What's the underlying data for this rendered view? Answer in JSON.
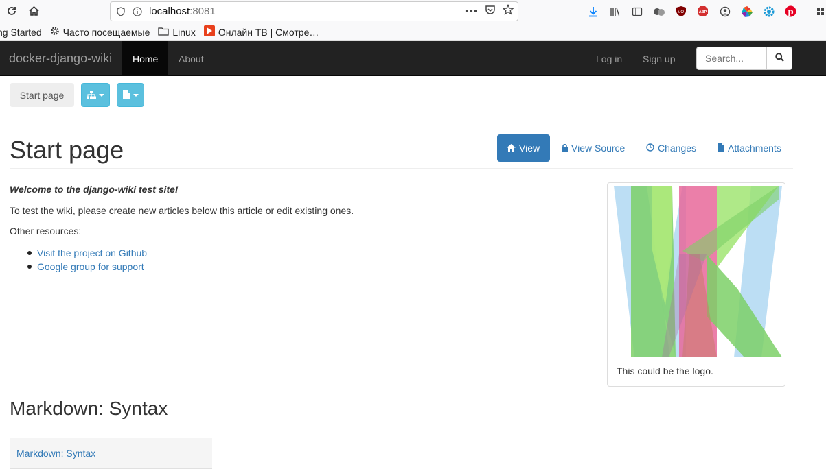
{
  "browser": {
    "url_host": "localhost",
    "url_port": ":8081",
    "bookmarks": [
      {
        "label": "ng Started",
        "icon": "firefox-icon"
      },
      {
        "label": "Часто посещаемые",
        "icon": "gear-icon"
      },
      {
        "label": "Linux",
        "icon": "folder-icon"
      },
      {
        "label": "Онлайн ТВ | Смотре…",
        "icon": "tv-icon"
      }
    ],
    "extension_icons": [
      "download-icon",
      "library-icon",
      "reader-icon",
      "ext-circles-icon",
      "ublock-icon",
      "adblock-plus-icon",
      "account-icon",
      "color-wheel-icon",
      "gear-extension-icon",
      "pinterest-icon"
    ]
  },
  "navbar": {
    "brand": "docker-django-wiki",
    "items": [
      {
        "label": "Home",
        "active": true
      },
      {
        "label": "About",
        "active": false
      }
    ],
    "login": "Log in",
    "signup": "Sign up",
    "search_placeholder": "Search..."
  },
  "toolbar": {
    "start_page": "Start page"
  },
  "page": {
    "title": "Start page",
    "tabs": [
      {
        "label": "View",
        "icon": "home-icon",
        "active": true
      },
      {
        "label": "View Source",
        "icon": "lock-icon",
        "active": false
      },
      {
        "label": "Changes",
        "icon": "clock-icon",
        "active": false
      },
      {
        "label": "Attachments",
        "icon": "file-icon",
        "active": false
      }
    ]
  },
  "article": {
    "welcome": "Welcome to the django-wiki test site!",
    "intro": "To test the wiki, please create new articles below this article or edit existing ones.",
    "resources_label": "Other resources:",
    "resources": [
      "Visit the project on Github",
      "Google group for support"
    ],
    "logo_caption": "This could be the logo."
  },
  "section": {
    "title": "Markdown: Syntax",
    "toc_link": "Markdown: Syntax"
  },
  "colors": {
    "navbar_bg": "#222222",
    "link": "#337ab7",
    "info_button": "#5bc0de",
    "logo_green": "#7dd067",
    "logo_pink": "#e8699a",
    "logo_blue": "#9fd0ef"
  }
}
